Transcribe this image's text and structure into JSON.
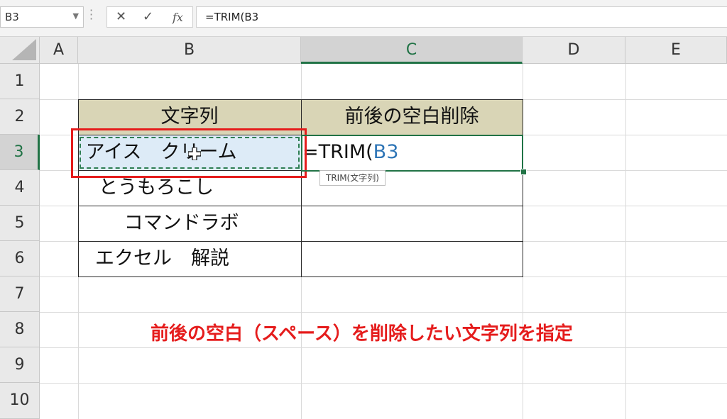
{
  "formula_bar": {
    "name_box": "B3",
    "cancel_icon": "✕",
    "enter_icon": "✓",
    "fx_label": "fx",
    "formula": "=TRIM(B3"
  },
  "columns": [
    "A",
    "B",
    "C",
    "D",
    "E"
  ],
  "selected_column": "C",
  "rows": [
    "1",
    "2",
    "3",
    "4",
    "5",
    "6",
    "7",
    "8",
    "9",
    "10"
  ],
  "selected_row": "3",
  "table": {
    "header_b": "文字列",
    "header_c": "前後の空白削除",
    "b3": " アイス　クリーム ",
    "b4": "　とうもろこし",
    "b5": "　　 コマンドラボ",
    "b6": "エクセル　解説",
    "c3_eq": "=TRIM(",
    "c3_ref": "B3"
  },
  "tooltip": "TRIM(文字列)",
  "annotation": "前後の空白（スペース）を削除したい文字列を指定",
  "colors": {
    "header_fill": "#d9d5b6",
    "selection_fill": "#ddebf7",
    "excel_green": "#217346",
    "annotation_red": "#e51c1c",
    "reference_blue": "#2e75b6"
  }
}
